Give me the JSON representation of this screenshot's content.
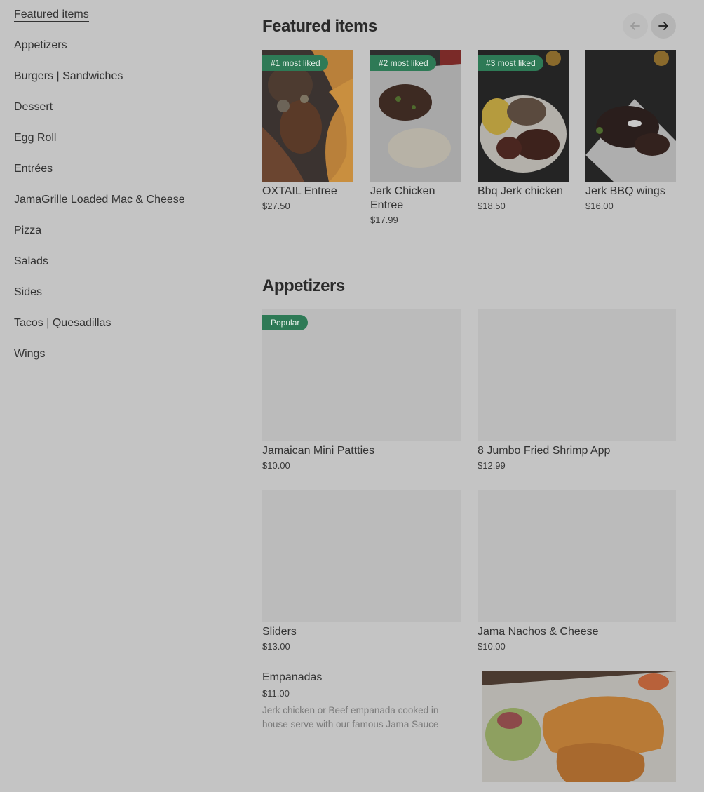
{
  "sidebar": {
    "items": [
      {
        "label": "Featured items"
      },
      {
        "label": "Appetizers"
      },
      {
        "label": "Burgers | Sandwiches"
      },
      {
        "label": "Dessert"
      },
      {
        "label": "Egg Roll"
      },
      {
        "label": "Entrées"
      },
      {
        "label": "JamaGrille Loaded Mac & Cheese"
      },
      {
        "label": "Pizza"
      },
      {
        "label": "Salads"
      },
      {
        "label": "Sides"
      },
      {
        "label": "Tacos | Quesadillas"
      },
      {
        "label": "Wings"
      }
    ]
  },
  "featured": {
    "title": "Featured items",
    "items": [
      {
        "badge": "#1 most liked",
        "name": "OXTAIL Entree",
        "price": "$27.50"
      },
      {
        "badge": "#2 most liked",
        "name": "Jerk Chicken Entree",
        "price": "$17.99"
      },
      {
        "badge": "#3 most liked",
        "name": "Bbq Jerk chicken",
        "price": "$18.50"
      },
      {
        "name": "Jerk BBQ wings",
        "price": "$16.00"
      }
    ]
  },
  "appetizers": {
    "title": "Appetizers",
    "items": [
      {
        "badge": "Popular",
        "name": "Jamaican Mini Pattties",
        "price": "$10.00"
      },
      {
        "name": "8 Jumbo Fried Shrimp App",
        "price": "$12.99"
      },
      {
        "name": "Sliders",
        "price": "$13.00"
      },
      {
        "name": "Jama Nachos & Cheese",
        "price": "$10.00"
      },
      {
        "name": "Empanadas",
        "price": "$11.00",
        "description": "Jerk chicken or Beef empanada cooked in house serve with our famous Jama Sauce"
      }
    ]
  },
  "colors": {
    "badge": "#2e7a56",
    "overlay": "#c4c4c4"
  },
  "icons": {
    "prev": "arrow-left-icon",
    "next": "arrow-right-icon"
  }
}
